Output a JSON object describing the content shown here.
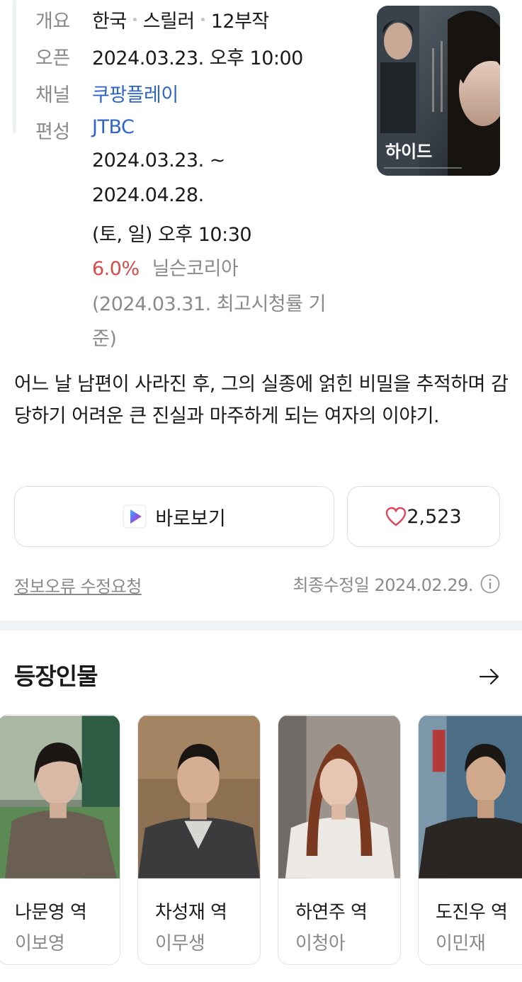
{
  "info": {
    "overview_label": "개요",
    "overview_country": "한국",
    "overview_genre": "스릴러",
    "overview_episodes": "12부작",
    "open_label": "오픈",
    "open_value": "2024.03.23. 오후 10:00",
    "channel_label": "채널",
    "channel_value": "쿠팡플레이",
    "schedule_label": "편성",
    "schedule_network": "JTBC",
    "schedule_line1": "2024.03.23. ~",
    "schedule_line2": "2024.04.28.",
    "schedule_line3": "(토, 일) 오후 10:30",
    "rating_value": "6.0%",
    "rating_source": "닐슨코리아",
    "rating_note_line1": "(2024.03.31. 최고시청률 기",
    "rating_note_line2": "준)"
  },
  "poster": {
    "title": "하이드"
  },
  "description": "어느 날 남편이 사라진 후, 그의 실종에 얽힌 비밀을 추적하며 감당하기 어려운 큰 진실과 마주하게 되는 여자의 이야기.",
  "actions": {
    "watch_label": "바로보기",
    "like_count": "2,523"
  },
  "footer": {
    "error_report": "정보오류 수정요청",
    "last_modified": "최종수정일 2024.02.29."
  },
  "characters": {
    "title": "등장인물",
    "items": [
      {
        "role": "나문영 역",
        "actor": "이보영"
      },
      {
        "role": "차성재 역",
        "actor": "이무생"
      },
      {
        "role": "하연주 역",
        "actor": "이청아"
      },
      {
        "role": "도진우 역",
        "actor": "이민재"
      }
    ]
  },
  "colors": {
    "link": "#2f65c9",
    "rating": "#d94a4a",
    "like": "#e0455a",
    "muted": "#8a8a8a"
  }
}
